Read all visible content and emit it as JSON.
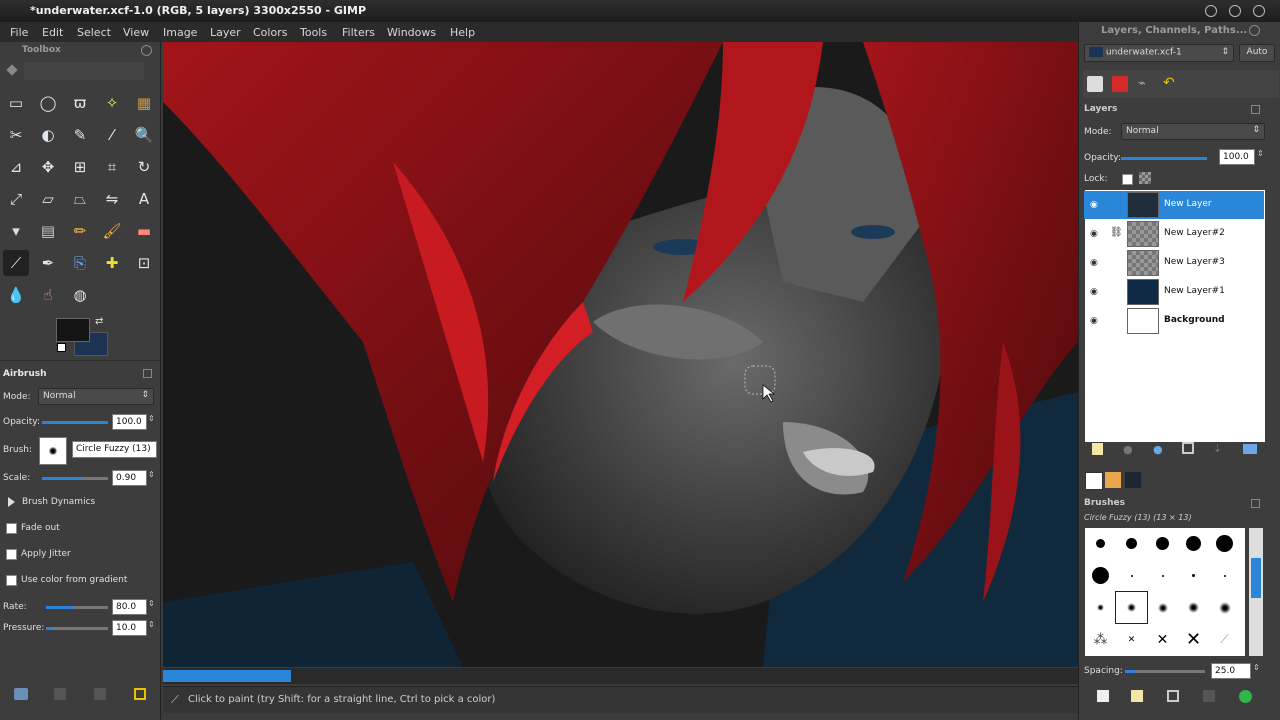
{
  "window": {
    "title": "*underwater.xcf-1.0 (RGB, 5 layers) 3300x2550 - GIMP"
  },
  "menu": [
    "File",
    "Edit",
    "Select",
    "View",
    "Image",
    "Layer",
    "Colors",
    "Tools",
    "Filters",
    "Windows",
    "Help"
  ],
  "toolbox": {
    "title": "Toolbox",
    "tools": [
      "rect-select-icon",
      "ellipse-select-icon",
      "free-select-icon",
      "fuzzy-select-icon",
      "color-select-icon",
      "scissors-icon",
      "foreground-select-icon",
      "paths-icon",
      "color-picker-icon",
      "zoom-icon",
      "measure-icon",
      "move-icon",
      "align-icon",
      "crop-icon",
      "rotate-icon",
      "scale-icon",
      "shear-icon",
      "perspective-icon",
      "flip-icon",
      "text-icon",
      "bucket-fill-icon",
      "blend-icon",
      "pencil-icon",
      "paintbrush-icon",
      "eraser-icon",
      "airbrush-icon",
      "ink-icon",
      "clone-icon",
      "heal-icon",
      "perspective-clone-icon",
      "blur-icon",
      "smudge-icon",
      "dodge-burn-icon"
    ],
    "fg_color": "#141414",
    "bg_color": "#1d3354"
  },
  "tool_options": {
    "title": "Airbrush",
    "mode_label": "Mode:",
    "mode_value": "Normal",
    "opacity_label": "Opacity:",
    "opacity_value": "100.0",
    "opacity_fraction": 1.0,
    "brush_label": "Brush:",
    "brush_value": "Circle Fuzzy (13)",
    "scale_label": "Scale:",
    "scale_value": "0.90",
    "brush_dynamics_label": "Brush Dynamics",
    "fade_out_label": "Fade out",
    "apply_jitter_label": "Apply Jitter",
    "use_gradient_label": "Use color from gradient",
    "rate_label": "Rate:",
    "rate_value": "80.0",
    "pressure_label": "Pressure:",
    "pressure_value": "10.0"
  },
  "status": {
    "message": "Click to paint (try Shift: for a straight line, Ctrl to pick a color)",
    "progress_fraction": 0.14
  },
  "layers_dock": {
    "title": "Layers, Channels, Paths...",
    "image_selector": "underwater.xcf-1",
    "auto_label": "Auto",
    "section_title": "Layers",
    "mode_label": "Mode:",
    "mode_value": "Normal",
    "opacity_label": "Opacity:",
    "opacity_value": "100.0",
    "lock_label": "Lock:",
    "layers": [
      {
        "name": "New Layer",
        "selected": true,
        "thumb": "#1f2c3a",
        "bold": false,
        "linked": false
      },
      {
        "name": "New Layer#2",
        "selected": false,
        "thumb": "checker",
        "bold": false,
        "linked": true
      },
      {
        "name": "New Layer#3",
        "selected": false,
        "thumb": "checker",
        "bold": false,
        "linked": false
      },
      {
        "name": "New Layer#1",
        "selected": false,
        "thumb": "#0e2a45",
        "bold": false,
        "linked": false
      },
      {
        "name": "Background",
        "selected": false,
        "thumb": "#ffffff",
        "bold": true,
        "linked": false
      }
    ]
  },
  "brushes_dock": {
    "title": "Brushes",
    "current": "Circle Fuzzy (13) (13 × 13)",
    "spacing_label": "Spacing:",
    "spacing_value": "25.0"
  }
}
